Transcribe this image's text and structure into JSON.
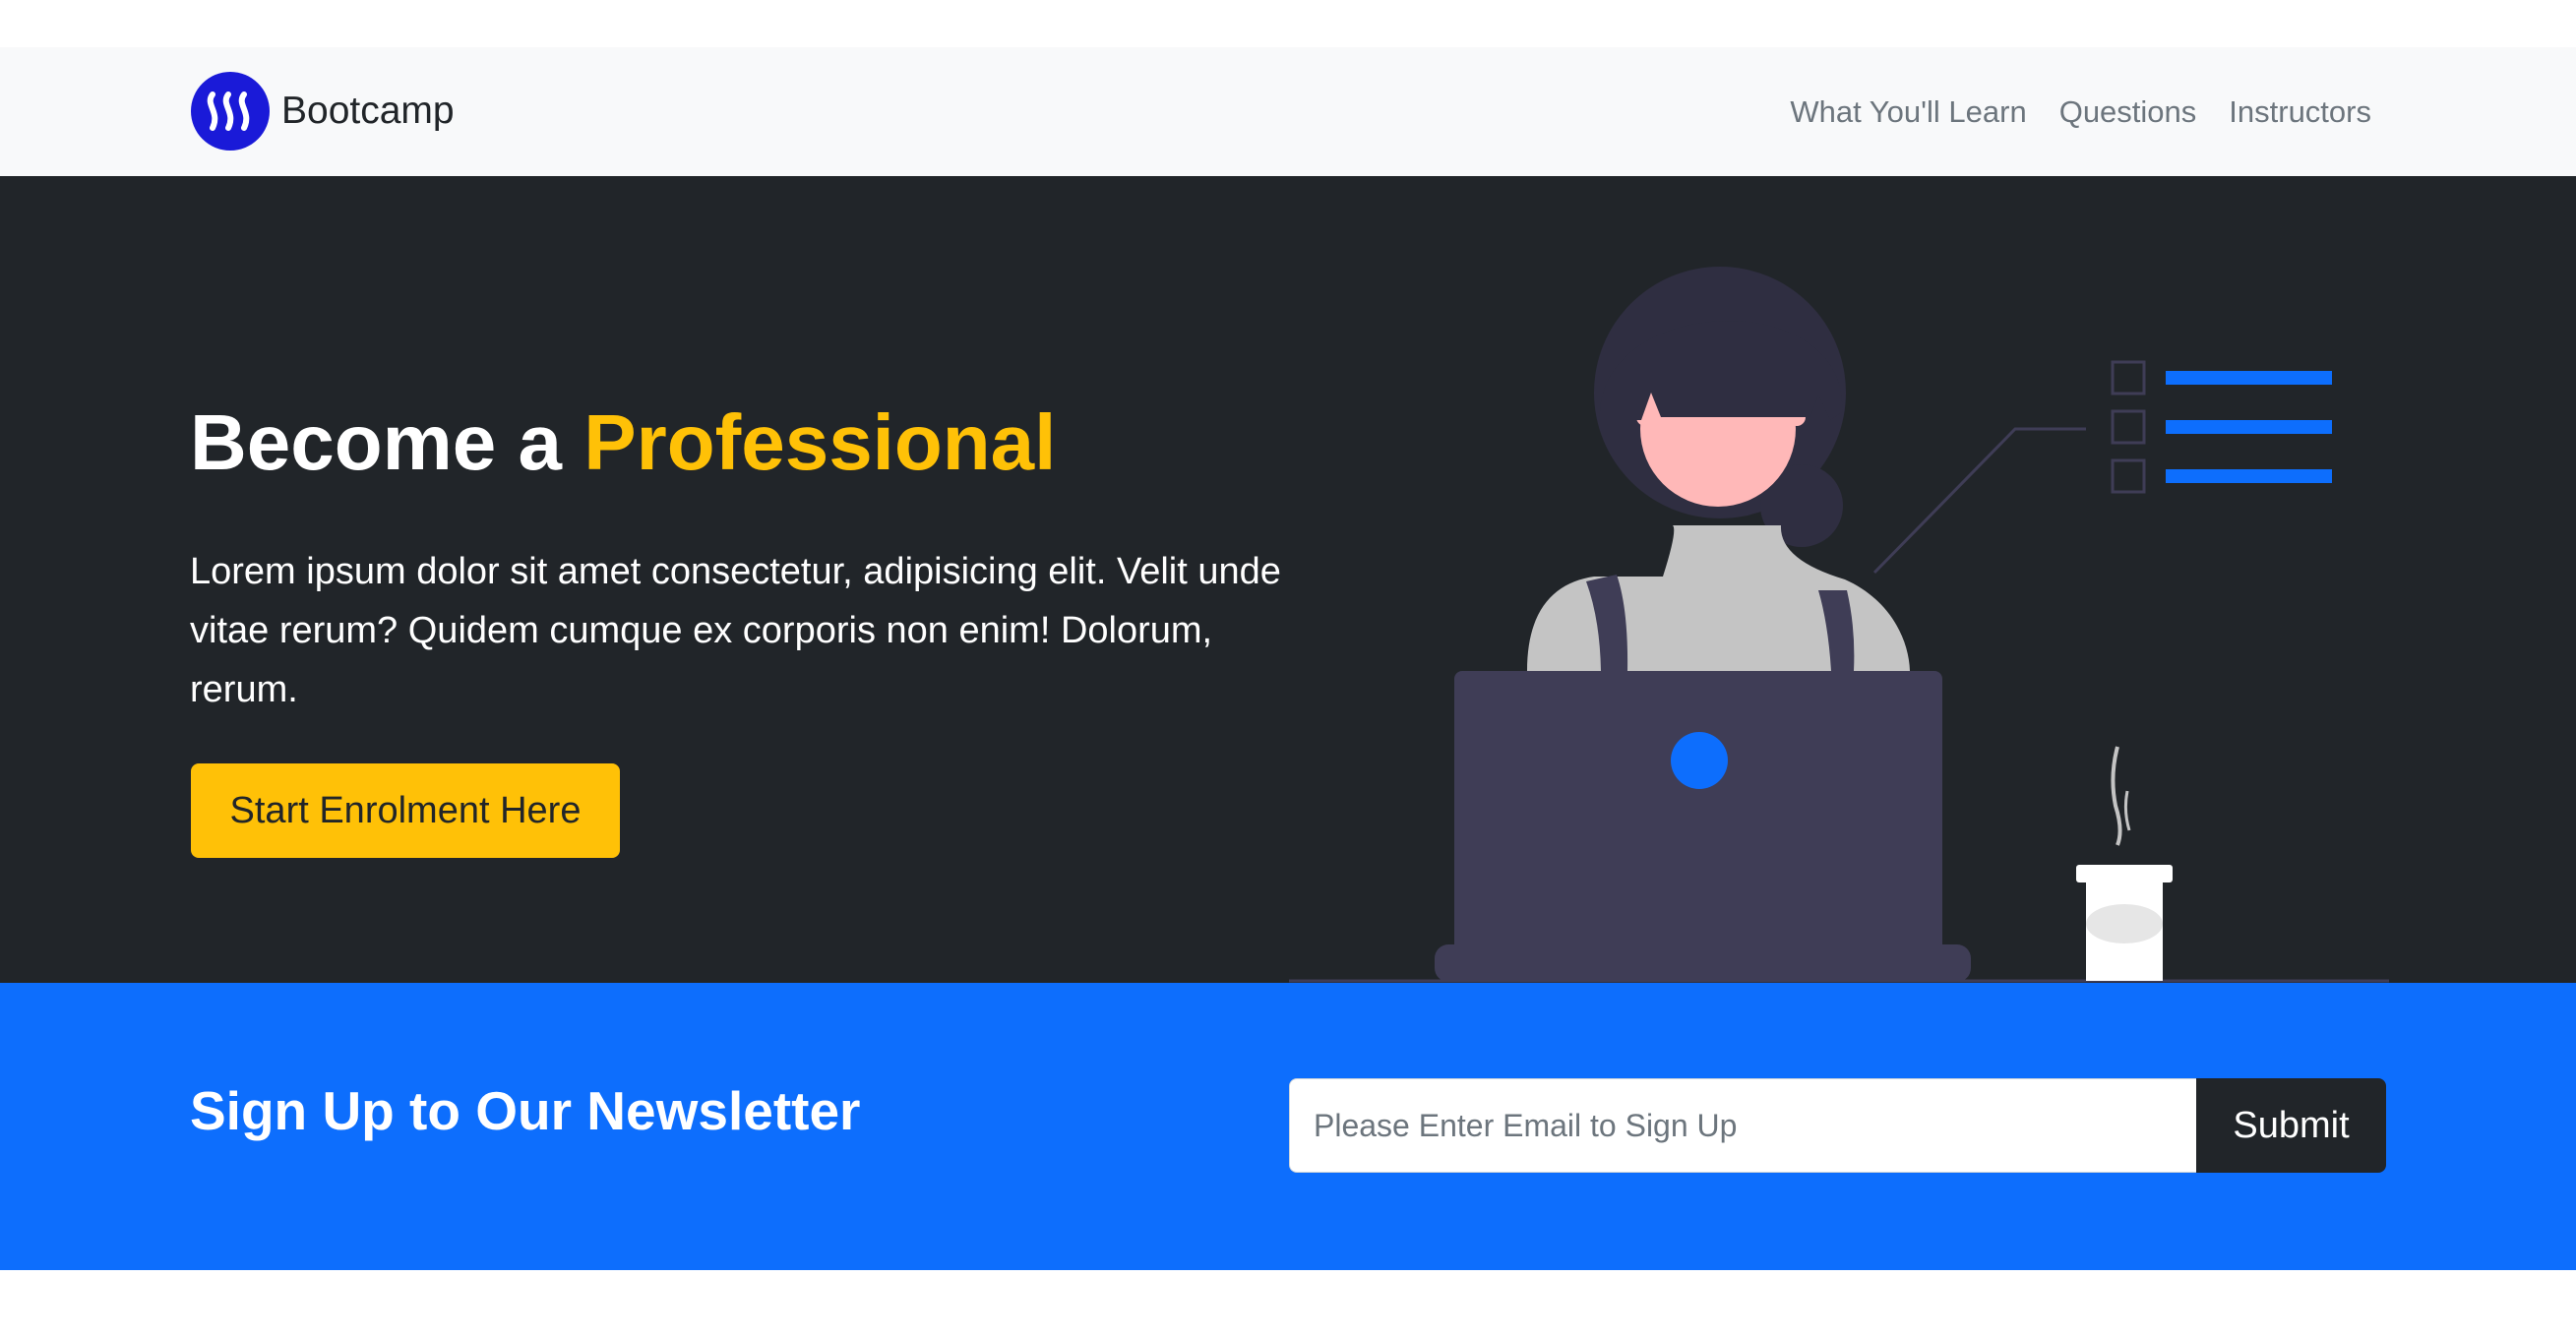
{
  "colors": {
    "navbar_bg": "#f8f9fa",
    "hero_bg": "#212529",
    "accent_yellow": "#ffc107",
    "primary_blue": "#0d6efd",
    "logo_blue": "#1a1ad8",
    "laptop": "#3f3d56",
    "skin": "#ffb8b8"
  },
  "navbar": {
    "brand_name": "Bootcamp",
    "brand_icon": "steem-logo-icon",
    "links": [
      {
        "label": "What You'll Learn"
      },
      {
        "label": "Questions"
      },
      {
        "label": "Instructors"
      }
    ]
  },
  "hero": {
    "title_prefix": "Become a ",
    "title_accent": "Professional",
    "text": "Lorem ipsum dolor sit amet consectetur, adipisicing elit. Velit unde vitae rerum? Quidem cumque ex corporis non enim! Dolorum, rerum.",
    "button_label": "Start Enrolment Here",
    "illustration": "woman-at-laptop-illustration"
  },
  "newsletter": {
    "title": "Sign Up to Our Newsletter",
    "email_placeholder": "Please Enter Email to Sign Up",
    "email_value": "",
    "submit_label": "Submit"
  }
}
